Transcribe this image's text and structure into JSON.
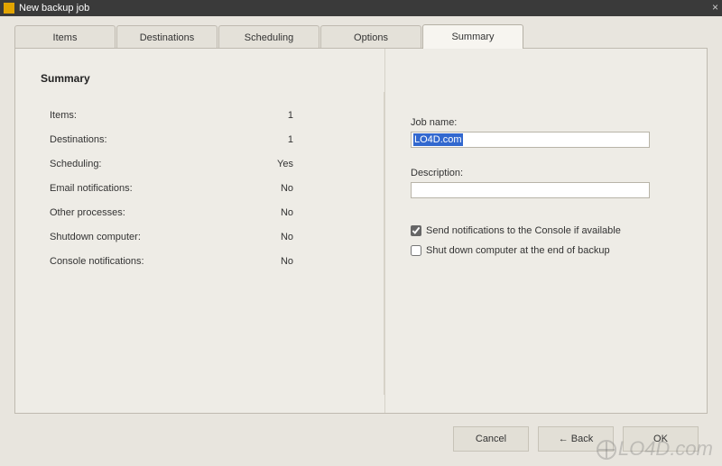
{
  "window": {
    "title": "New backup job",
    "close_glyph": "×"
  },
  "tabs": [
    {
      "label": "Items",
      "active": false
    },
    {
      "label": "Destinations",
      "active": false
    },
    {
      "label": "Scheduling",
      "active": false
    },
    {
      "label": "Options",
      "active": false
    },
    {
      "label": "Summary",
      "active": true
    }
  ],
  "summary": {
    "heading": "Summary",
    "rows": [
      {
        "label": "Items:",
        "value": "1"
      },
      {
        "label": "Destinations:",
        "value": "1"
      },
      {
        "label": "Scheduling:",
        "value": "Yes"
      },
      {
        "label": "Email notifications:",
        "value": "No"
      },
      {
        "label": "Other processes:",
        "value": "No"
      },
      {
        "label": "Shutdown computer:",
        "value": "No"
      },
      {
        "label": "Console notifications:",
        "value": "No"
      }
    ]
  },
  "form": {
    "jobname_label": "Job name:",
    "jobname_value": "LO4D.com",
    "description_label": "Description:",
    "description_value": "",
    "checkbox1": {
      "label": "Send notifications to the Console if available",
      "checked": true
    },
    "checkbox2": {
      "label": "Shut down computer at the end of backup",
      "checked": false
    }
  },
  "buttons": {
    "cancel": "Cancel",
    "back": "Back",
    "ok": "OK"
  },
  "watermark": "LO4D.com"
}
